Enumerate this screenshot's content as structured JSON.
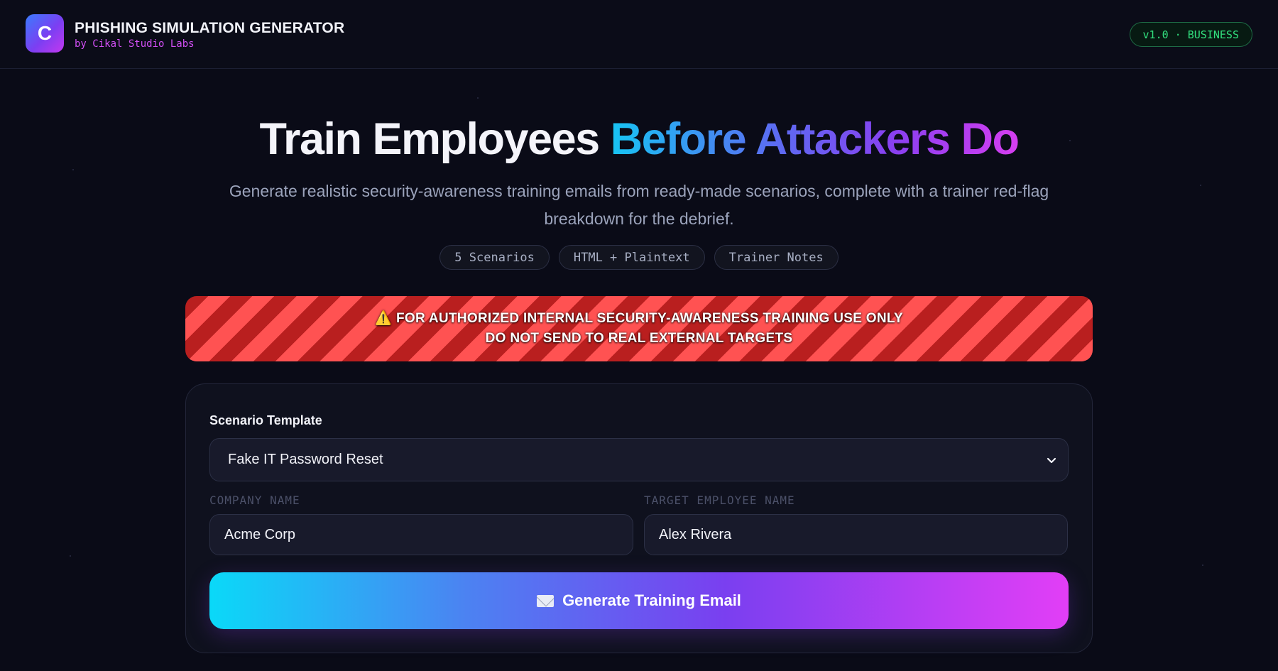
{
  "app": {
    "logo_letter": "C",
    "title": "PHISHING SIMULATION GENERATOR",
    "subtitle": "by Cikal Studio Labs",
    "version_badge": "v1.0 · BUSINESS"
  },
  "hero": {
    "title_plain": "Train Employees",
    "title_gradient": "Before Attackers Do",
    "description": "Generate realistic security-awareness training emails from ready-made scenarios, complete with a trainer red-flag breakdown for the debrief.",
    "pills": [
      "5 Scenarios",
      "HTML + Plaintext",
      "Trainer Notes"
    ]
  },
  "warning": {
    "icon": "⚠️",
    "line1": "FOR AUTHORIZED INTERNAL SECURITY-AWARENESS TRAINING USE ONLY",
    "line2": "DO NOT SEND TO REAL EXTERNAL TARGETS"
  },
  "form": {
    "scenario_label": "Scenario Template",
    "scenario_value": "Fake IT Password Reset",
    "company_label": "COMPANY NAME",
    "company_value": "Acme Corp",
    "employee_label": "TARGET EMPLOYEE NAME",
    "employee_value": "Alex Rivera",
    "generate_label": "Generate Training Email"
  },
  "colors": {
    "background": "#0a0b17",
    "accent_magenta": "#d24ff5",
    "badge_green": "#32e07e",
    "warning_red": "#ff5252"
  }
}
